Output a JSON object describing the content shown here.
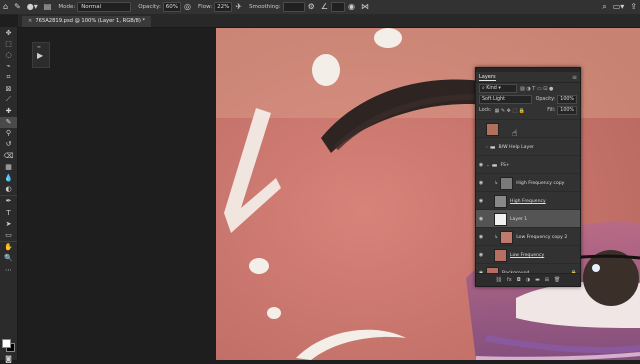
{
  "options_bar": {
    "mode_label": "Mode:",
    "mode_value": "Normal",
    "opacity_label": "Opacity:",
    "opacity_value": "60%",
    "flow_label": "Flow:",
    "flow_value": "22%",
    "smoothing_label": "Smoothing:",
    "smoothing_value": ""
  },
  "document": {
    "tab_title": "765A2819.psd @ 100% (Layer 1, RGB/8) *",
    "close_glyph": "×"
  },
  "layers_panel": {
    "title": "Layers",
    "kind": "Kind",
    "blend_mode": "Soft Light",
    "opacity_label": "Opacity:",
    "opacity": "100%",
    "lock_label": "Lock:",
    "fill_label": "Fill:",
    "fill": "100%",
    "layers": [
      {
        "name": "",
        "type": "smart",
        "visible": false
      },
      {
        "name": "B/W Help Layer",
        "type": "folder",
        "visible": false
      },
      {
        "name": "FS+",
        "type": "folder",
        "visible": true
      },
      {
        "name": "High Frequency copy",
        "type": "layer",
        "visible": true
      },
      {
        "name": "High Frequency",
        "type": "layer",
        "visible": true
      },
      {
        "name": "Layer 1",
        "type": "layer",
        "visible": true,
        "selected": true
      },
      {
        "name": "Low Frequency copy 2",
        "type": "layer",
        "visible": true
      },
      {
        "name": "Low Frequency",
        "type": "layer",
        "visible": true
      },
      {
        "name": "Background",
        "type": "layer",
        "visible": true
      }
    ]
  },
  "colors": {
    "foreground": "#ffffff",
    "background": "#000000",
    "panel": "#323232",
    "selection": "#545454"
  }
}
